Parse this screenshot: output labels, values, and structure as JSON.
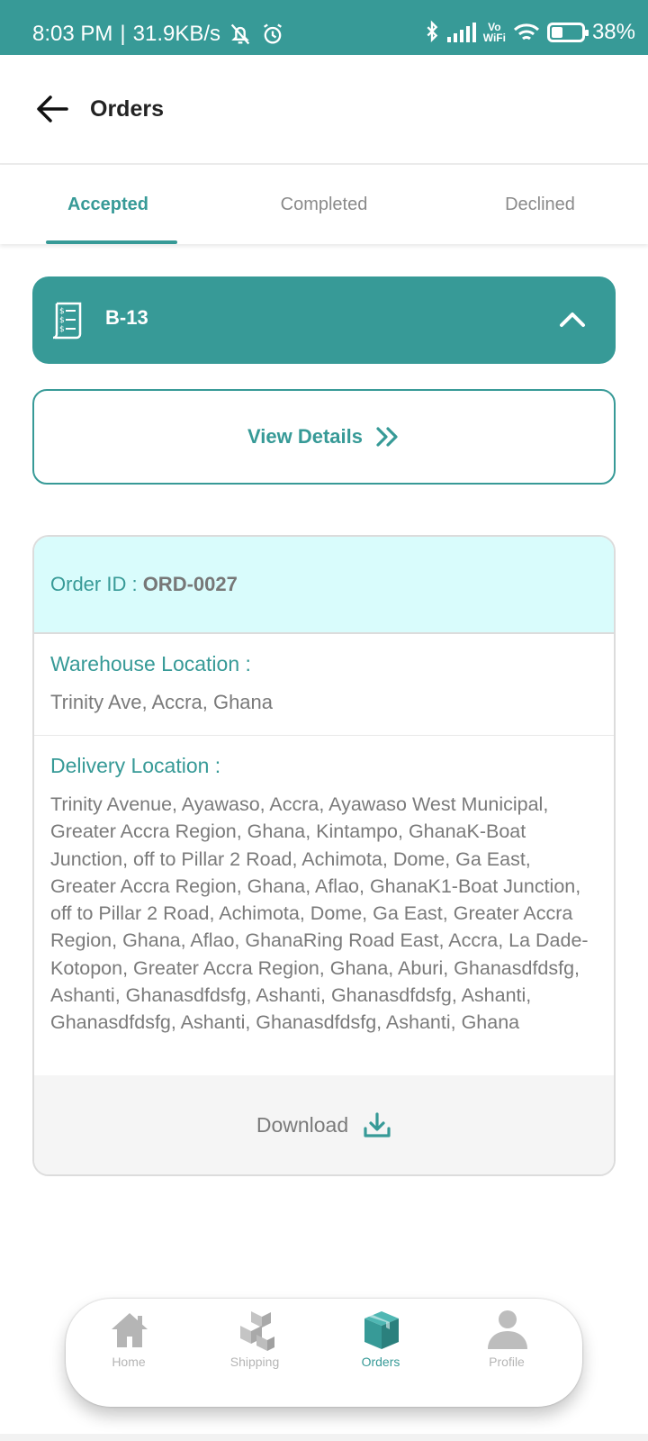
{
  "status_bar": {
    "time": "8:03 PM",
    "net_speed": "31.9KB/s",
    "vowifi_top": "Vo",
    "vowifi_bottom": "WiFi",
    "battery": "38%",
    "battery_level": 0.38
  },
  "header": {
    "title": "Orders"
  },
  "tabs": [
    {
      "label": "Accepted",
      "active": true
    },
    {
      "label": "Completed",
      "active": false
    },
    {
      "label": "Declined",
      "active": false
    }
  ],
  "batch": {
    "label": "B-13"
  },
  "view_details_label": "View Details",
  "order": {
    "id_label": "Order ID : ",
    "id_value": "ORD-0027",
    "warehouse_label": "Warehouse Location :",
    "warehouse_value": "Trinity Ave, Accra, Ghana",
    "delivery_label": "Delivery Location :",
    "delivery_value": "Trinity Avenue, Ayawaso, Accra, Ayawaso West Municipal, Greater Accra Region, Ghana, Kintampo, GhanaK-Boat Junction, off to Pillar 2 Road, Achimota, Dome, Ga East, Greater Accra Region, Ghana, Aflao, GhanaK1-Boat Junction, off to Pillar 2 Road, Achimota, Dome, Ga East, Greater Accra Region, Ghana, Aflao, GhanaRing Road East, Accra, La Dade-Kotopon, Greater Accra Region, Ghana, Aburi, Ghanasdfdsfg, Ashanti, Ghanasdfdsfg, Ashanti, Ghanasdfdsfg, Ashanti, Ghanasdfdsfg, Ashanti, Ghanasdfdsfg, Ashanti, Ghana",
    "download_label": "Download"
  },
  "bottom_nav": [
    {
      "label": "Home",
      "icon": "home-icon",
      "active": false
    },
    {
      "label": "Shipping",
      "icon": "boxes-icon",
      "active": false
    },
    {
      "label": "Orders",
      "icon": "package-icon",
      "active": true
    },
    {
      "label": "Profile",
      "icon": "person-icon",
      "active": false
    }
  ],
  "colors": {
    "primary": "#379a97",
    "order_header_bg": "#d9fcfc",
    "inactive_gray": "#b5b5b5"
  }
}
